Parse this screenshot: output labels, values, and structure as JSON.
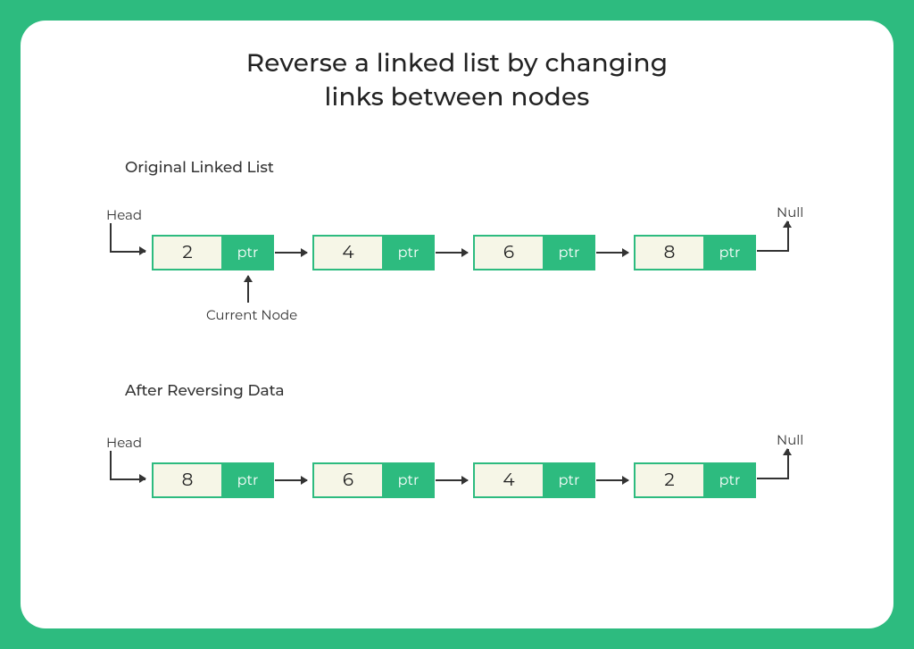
{
  "title_line1": "Reverse a linked list by changing",
  "title_line2": "links between nodes",
  "section1_label": "Original Linked List",
  "section2_label": "After Reversing Data",
  "labels": {
    "head": "Head",
    "null": "Null",
    "current": "Current Node",
    "ptr": "ptr"
  },
  "colors": {
    "accent": "#2dbb7f",
    "node_bg": "#f6f6e7",
    "line": "#333333"
  },
  "original": {
    "nodes": [
      {
        "value": "2"
      },
      {
        "value": "4"
      },
      {
        "value": "6"
      },
      {
        "value": "8"
      }
    ]
  },
  "reversed": {
    "nodes": [
      {
        "value": "8"
      },
      {
        "value": "6"
      },
      {
        "value": "4"
      },
      {
        "value": "2"
      }
    ]
  }
}
